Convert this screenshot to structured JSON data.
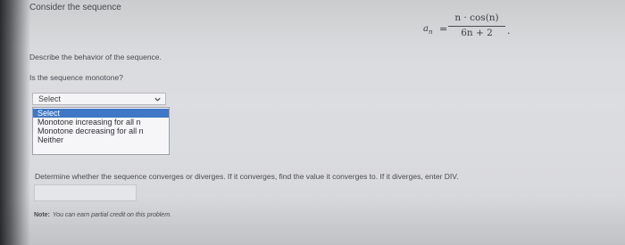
{
  "problem": {
    "prompt": "Consider the sequence",
    "formula": {
      "lhs": "a_n",
      "equals": "=",
      "numerator": "n · cos(n)",
      "denominator": "6n + 2",
      "period": "."
    }
  },
  "question1": {
    "text": "Describe the behavior of the sequence."
  },
  "question2": {
    "text": "Is the sequence monotone?",
    "select_value": "Select",
    "options": [
      "Select",
      "Monotone increasing for all n",
      "Monotone decreasing for all n",
      "Neither"
    ],
    "highlighted_option": "Select"
  },
  "question3": {
    "text": "Determine whether the sequence converges or diverges. If it converges, find the value it converges to. If it diverges, enter DIV.",
    "answer_value": ""
  },
  "note": {
    "label": "Note:",
    "text": "You can earn partial credit on this problem."
  },
  "colors": {
    "highlight": "#3f78c6",
    "background": "#d9dadd"
  },
  "icons": {
    "dropdown": "chevron-down-icon"
  }
}
